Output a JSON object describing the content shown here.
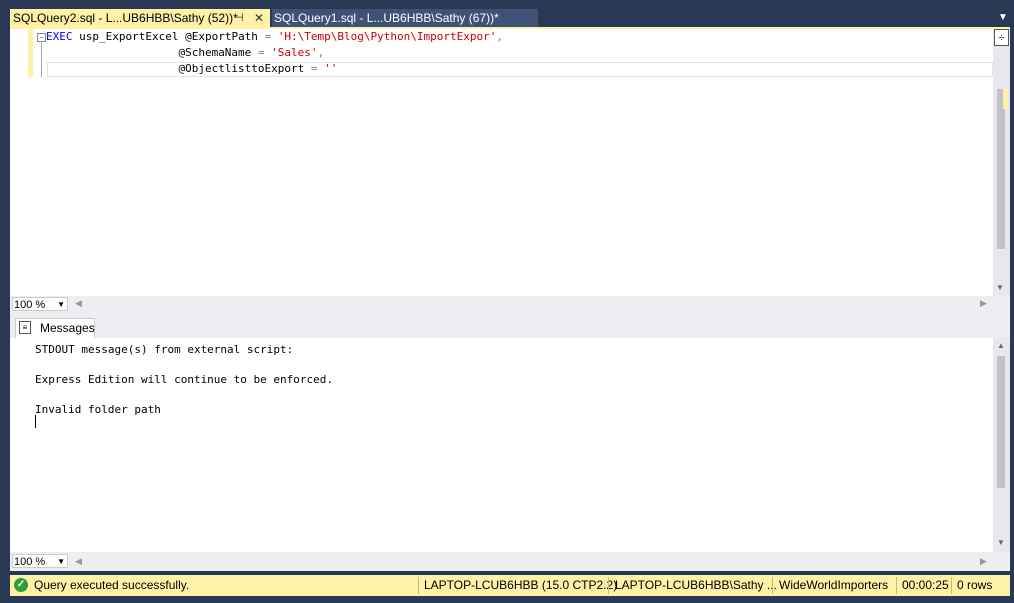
{
  "tabs": [
    {
      "label": "SQLQuery2.sql - L...UB6HBB\\Sathy (52))*",
      "active": true
    },
    {
      "label": "SQLQuery1.sql - L...UB6HBB\\Sathy (67))*",
      "active": false
    }
  ],
  "icons": {
    "pin": "pin-icon",
    "close": "close-icon",
    "overflow": "chevron-down-icon",
    "messages": "messages-icon",
    "success": "check-circle-icon"
  },
  "editor": {
    "line1": {
      "kw": "EXEC",
      "rest": " usp_ExportExcel @ExportPath ",
      "op": "=",
      "str": "'H:\\Temp\\Blog\\Python\\ImportExpor'",
      "tail": ","
    },
    "line2": {
      "pad": "                    ",
      "param": "@SchemaName ",
      "op": "=",
      "str": "'Sales'",
      "tail": ","
    },
    "line3": {
      "pad": "                    ",
      "param": "@ObjectlisttoExport ",
      "op": "=",
      "str": "''"
    }
  },
  "editor_zoom": "100 %",
  "results": {
    "tab_label": "Messages",
    "messages": "STDOUT message(s) from external script:\n\nExpress Edition will continue to be enforced.\n\nInvalid folder path",
    "zoom": "100 %"
  },
  "status": {
    "message": "Query executed successfully.",
    "server": "LAPTOP-LCUB6HBB (15.0 CTP2.2)",
    "user": "LAPTOP-LCUB6HBB\\Sathy ...",
    "database": "WideWorldImporters",
    "elapsed": "00:00:25",
    "rows": "0 rows"
  },
  "colors": {
    "accent": "#fff1a5",
    "frame": "#293955",
    "keyword": "#0000ff",
    "string": "#c80000"
  }
}
